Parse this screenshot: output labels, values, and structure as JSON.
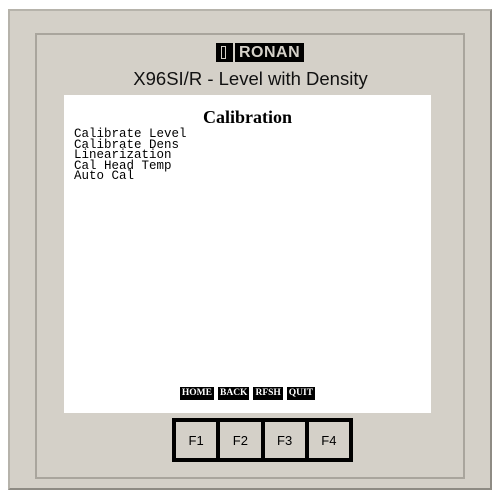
{
  "device": {
    "brand_logo": "RONAN",
    "model_title": "X96SI/R - Level with Density"
  },
  "screen": {
    "title": "Calibration",
    "menu_items": [
      "Calibrate Level",
      "Calibrate Dens",
      "Linearization",
      "Cal Head Temp",
      "Auto Cal"
    ]
  },
  "softkeys": [
    "HOME",
    "BACK",
    "RFSH",
    "QUIT"
  ],
  "function_keys": [
    "F1",
    "F2",
    "F3",
    "F4"
  ]
}
